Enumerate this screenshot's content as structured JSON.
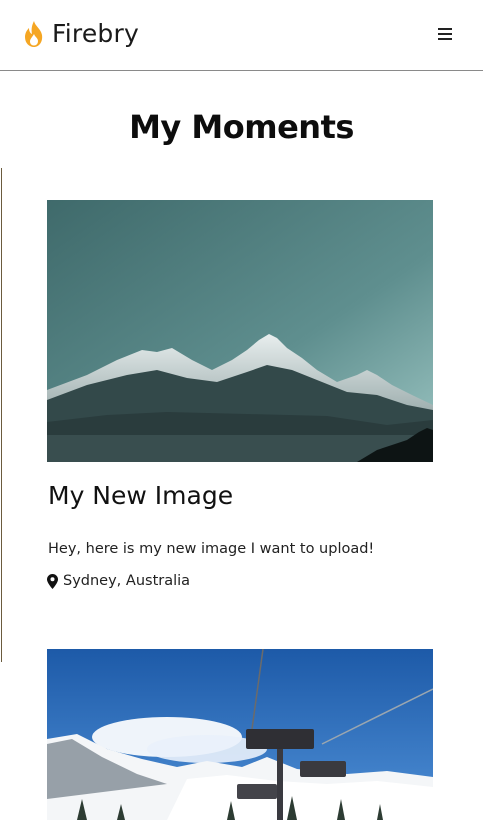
{
  "navbar": {
    "brand_name": "Firebry",
    "logo_icon": "flame-icon",
    "menu_icon": "hamburger-menu-icon",
    "accent_color": "#f5a623"
  },
  "page": {
    "title": "My Moments"
  },
  "posts": [
    {
      "image": "mountain-peaks-photo",
      "title": "My New Image",
      "description": "Hey, here is my new image I want to upload!",
      "location_icon": "map-pin-icon",
      "location": "Sydney, Australia"
    },
    {
      "image": "ski-lift-snow-photo"
    }
  ]
}
